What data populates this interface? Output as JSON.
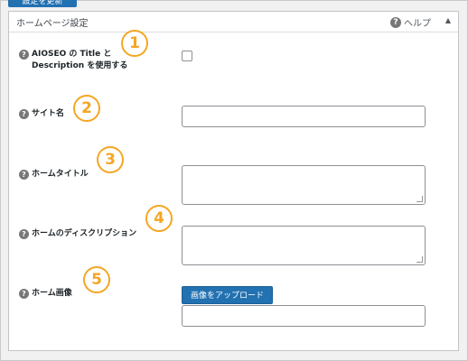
{
  "top_button": {
    "label": "設定を更新"
  },
  "panel": {
    "title": "ホームページ設定",
    "help_label": "ヘルプ",
    "toggle_icon": "triangle-up-icon"
  },
  "fields": [
    {
      "label_line1": "AIOSEO の Title と",
      "label_line2": "Description を使用する",
      "control": "checkbox",
      "checked": false,
      "badge": "1"
    },
    {
      "label": "サイト名",
      "control": "text",
      "value": "",
      "badge": "2"
    },
    {
      "label": "ホームタイトル",
      "control": "textarea",
      "value": "",
      "badge": "3"
    },
    {
      "label": "ホームのディスクリプション",
      "control": "textarea",
      "value": "",
      "badge": "4"
    },
    {
      "label": "ホーム画像",
      "control": "upload",
      "button_label": "画像をアップロード",
      "value": "",
      "badge": "5"
    }
  ],
  "colors": {
    "accent": "#2271b1",
    "badge": "#f5a623",
    "help_icon": "#777777"
  }
}
